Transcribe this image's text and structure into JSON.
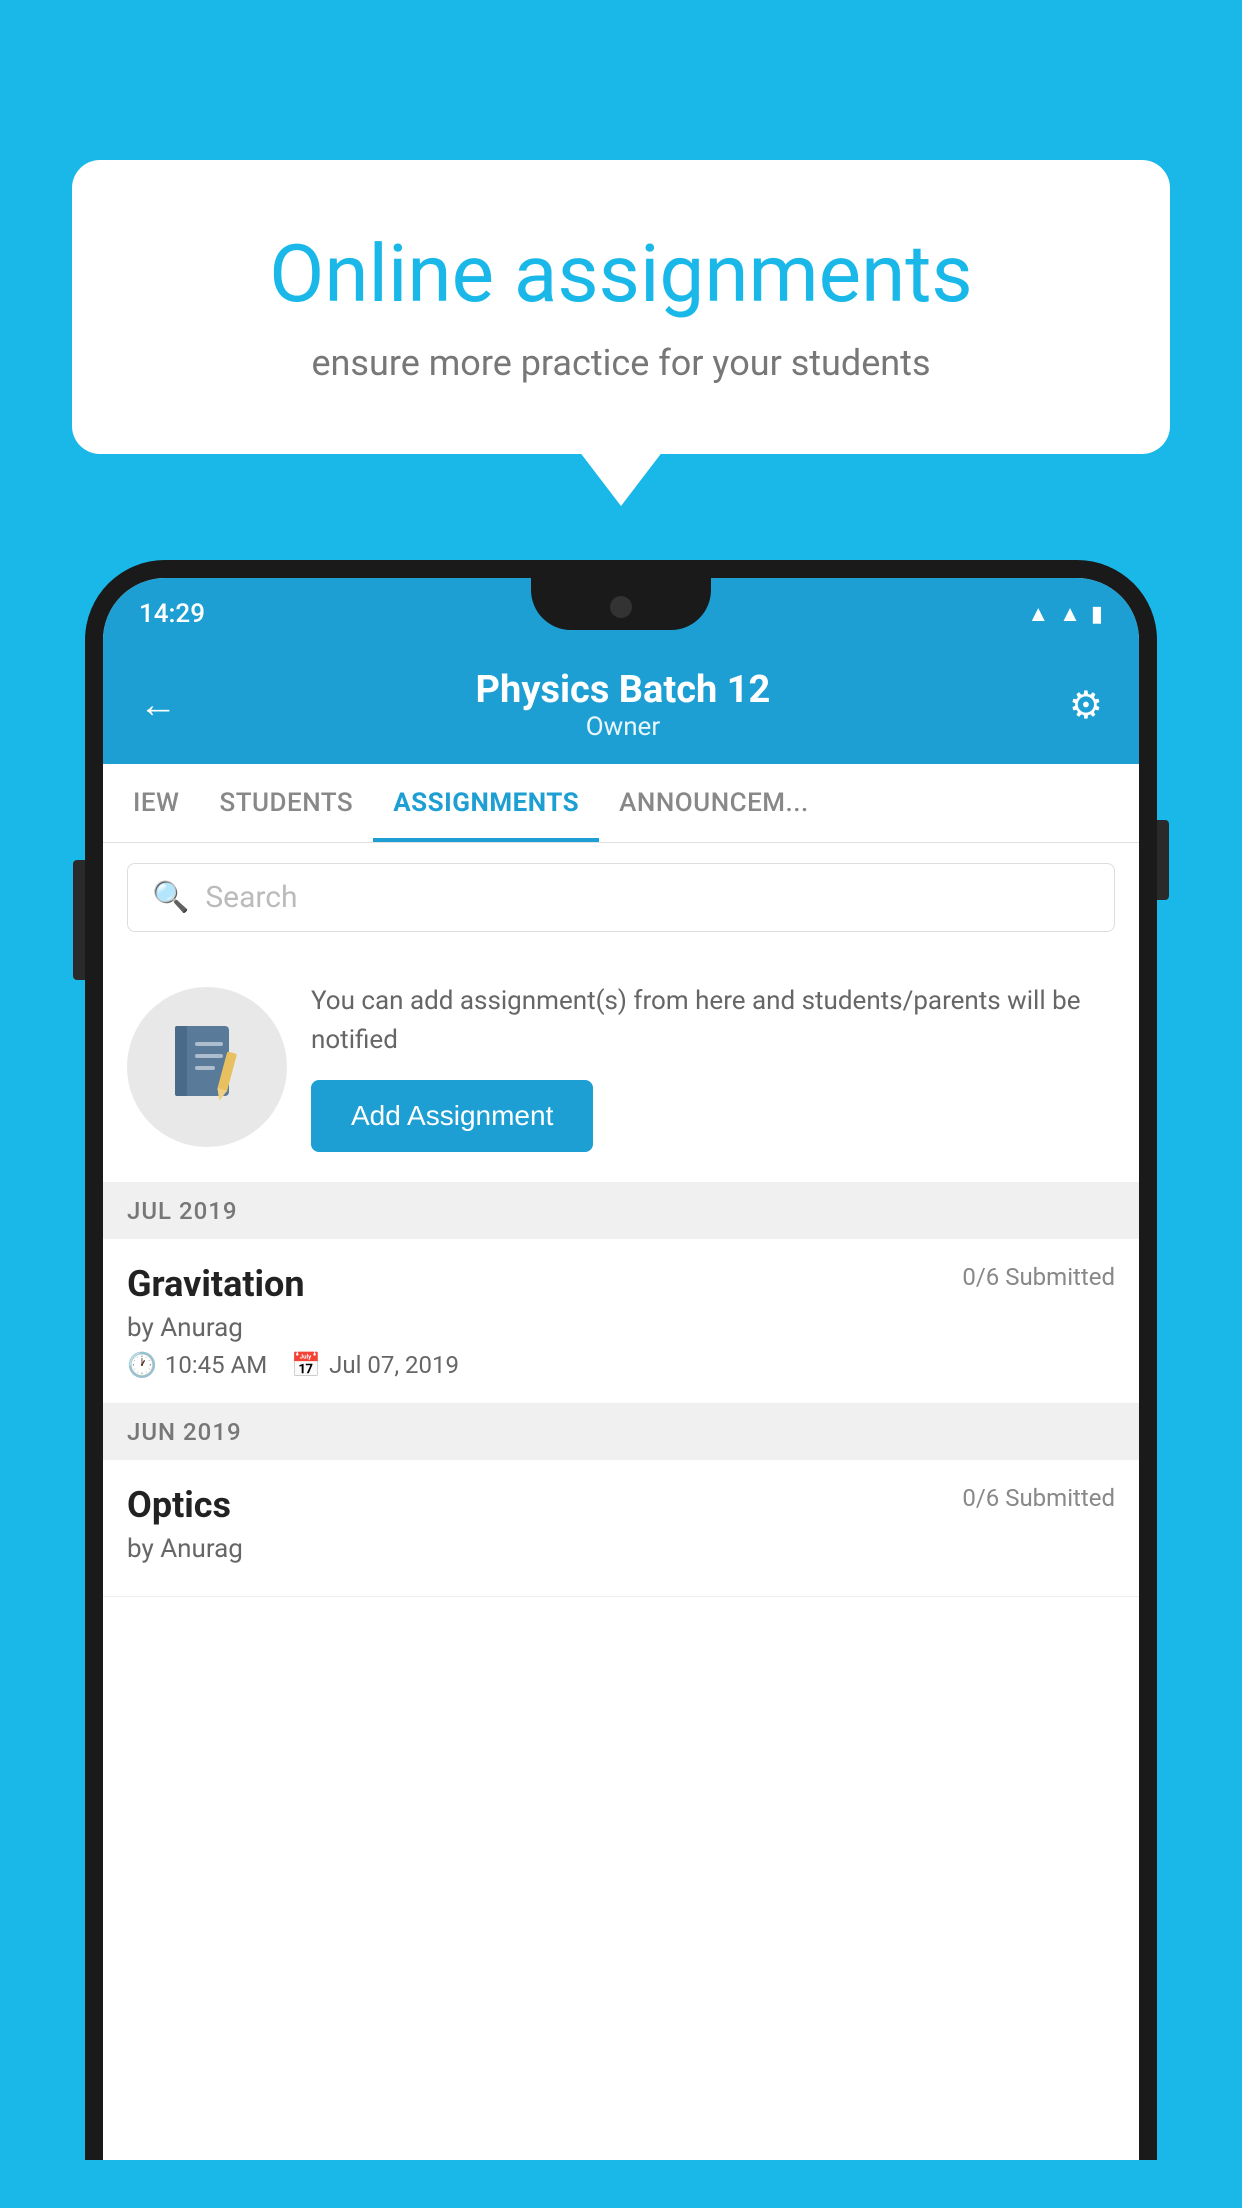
{
  "page": {
    "background_color": "#1ab8e8"
  },
  "speech_bubble": {
    "title": "Online assignments",
    "subtitle": "ensure more practice for your students"
  },
  "status_bar": {
    "time": "14:29",
    "icons": [
      "wifi",
      "signal",
      "battery"
    ]
  },
  "app_header": {
    "title": "Physics Batch 12",
    "subtitle": "Owner",
    "back_label": "←",
    "settings_label": "⚙"
  },
  "tabs": [
    {
      "label": "IEW",
      "active": false
    },
    {
      "label": "STUDENTS",
      "active": false
    },
    {
      "label": "ASSIGNMENTS",
      "active": true
    },
    {
      "label": "ANNOUNCEM...",
      "active": false
    }
  ],
  "search": {
    "placeholder": "Search"
  },
  "promo": {
    "description": "You can add assignment(s) from here and students/parents will be notified",
    "button_label": "Add Assignment"
  },
  "sections": [
    {
      "month_label": "JUL 2019",
      "assignments": [
        {
          "name": "Gravitation",
          "submitted": "0/6 Submitted",
          "by": "by Anurag",
          "time": "10:45 AM",
          "date": "Jul 07, 2019"
        }
      ]
    },
    {
      "month_label": "JUN 2019",
      "assignments": [
        {
          "name": "Optics",
          "submitted": "0/6 Submitted",
          "by": "by Anurag",
          "time": "",
          "date": ""
        }
      ]
    }
  ]
}
